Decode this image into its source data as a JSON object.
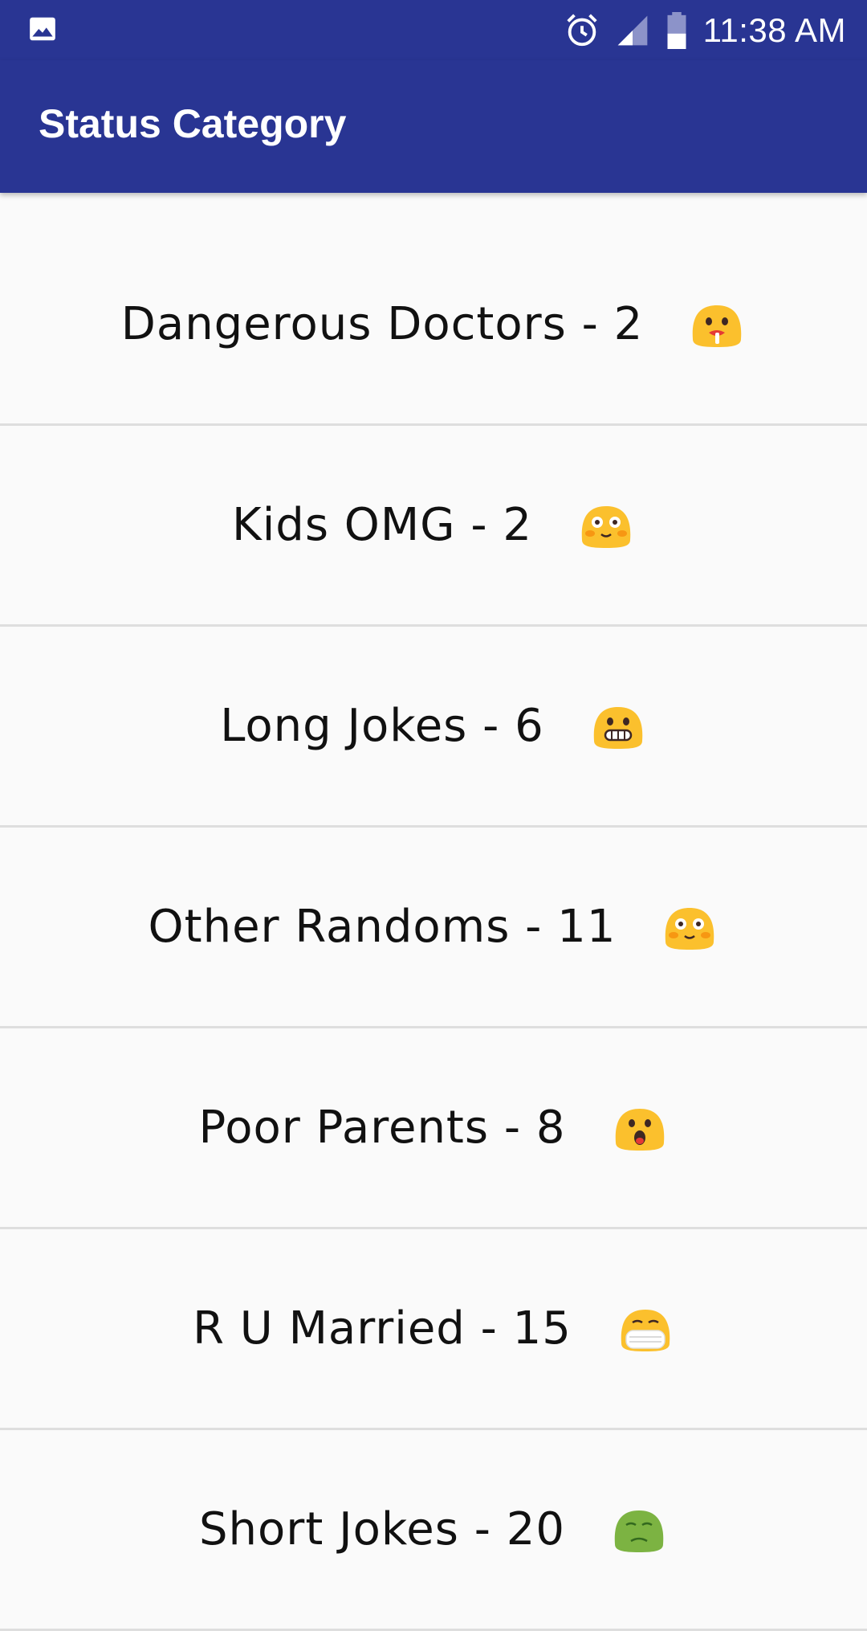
{
  "status_bar": {
    "time": "11:38 AM",
    "icons": [
      "image-icon",
      "alarm-icon",
      "signal-icon",
      "battery-icon"
    ]
  },
  "toolbar": {
    "title": "Status Category"
  },
  "categories": [
    {
      "label": "Dangerous Doctors - 2",
      "emoji": "drooling-face-icon"
    },
    {
      "label": "Kids OMG - 2",
      "emoji": "flushed-face-icon"
    },
    {
      "label": "Long Jokes - 6",
      "emoji": "grinning-face-icon"
    },
    {
      "label": "Other Randoms - 11",
      "emoji": "flushed-face-icon"
    },
    {
      "label": "Poor Parents - 8",
      "emoji": "surprised-face-icon"
    },
    {
      "label": "R U Married - 15",
      "emoji": "medical-mask-face-icon"
    },
    {
      "label": "Short Jokes - 20",
      "emoji": "nauseated-face-icon"
    }
  ],
  "colors": {
    "primary": "#293593",
    "background": "#fafafa",
    "divider": "#dedede",
    "emoji_yellow": "#fbc02d",
    "emoji_green": "#7cb342"
  }
}
